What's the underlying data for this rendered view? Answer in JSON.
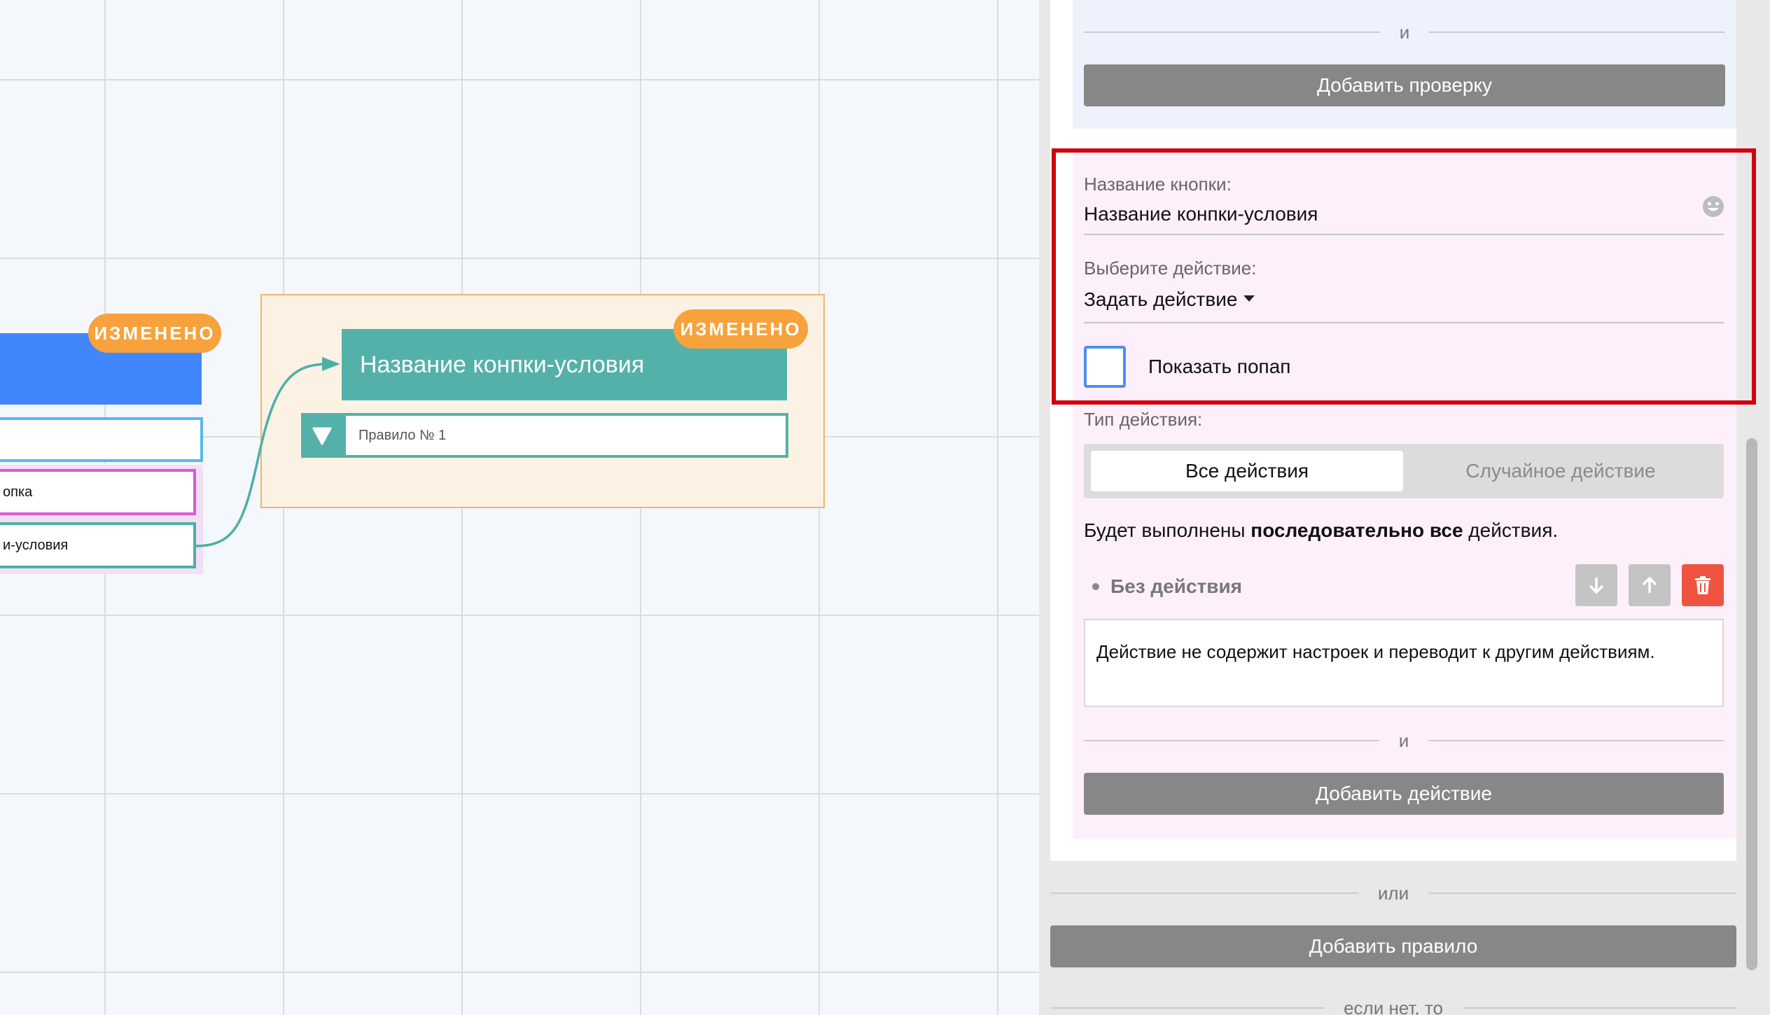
{
  "canvas": {
    "badge_left": "ИЗМЕНЕНО",
    "badge_right": "ИЗМЕНЕНО",
    "pink_item_text": "опка",
    "teal_item_text": "и-условия",
    "node_title": "Название конпки-условия",
    "rule_label": "Правило № 1"
  },
  "panel": {
    "top_divider": "и",
    "add_check_button": "Добавить проверку",
    "button_name_label": "Название кнопки:",
    "button_name_value": "Название конпки-условия",
    "choose_action_label": "Выберите действие:",
    "choose_action_value": "Задать действие",
    "show_popup_label": "Показать попап",
    "action_type_label": "Тип действия:",
    "action_type_options": [
      "Все действия",
      "Случайное действие"
    ],
    "action_type_selected": "Все действия",
    "sequence_text_prefix": "Будет выполнены ",
    "sequence_text_bold": "последовательно все",
    "sequence_text_suffix": " действия.",
    "action_item_title": "Без действия",
    "action_item_description": "Действие не содержит настроек и переводит к другим действиям.",
    "action_divider": "и",
    "add_action_button": "Добавить действие",
    "or_divider": "или",
    "add_rule_button": "Добавить правило",
    "else_divider": "если нет, то"
  },
  "colors": {
    "accent_blue": "#4286fb",
    "teal": "#54b1aa",
    "badge_orange": "#f7a23c",
    "highlight_red": "#d0000e",
    "delete_red": "#f0533f"
  }
}
